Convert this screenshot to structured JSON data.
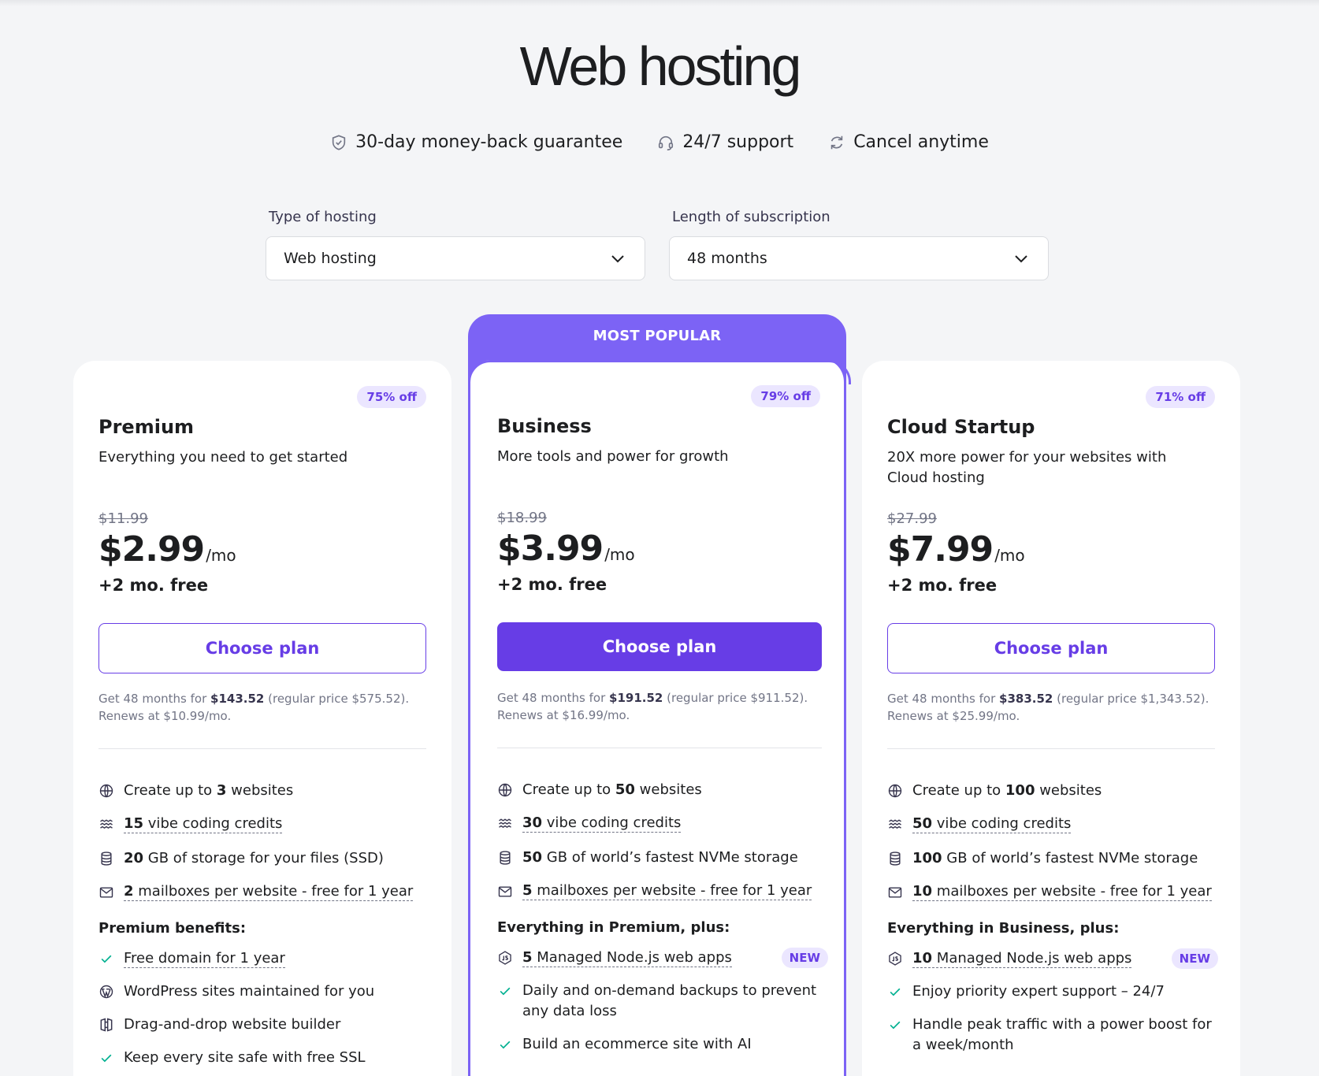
{
  "page": {
    "title": "Web hosting"
  },
  "badges": [
    {
      "icon": "shield-check-icon",
      "label": "30-day money-back guarantee"
    },
    {
      "icon": "headset-icon",
      "label": "24/7 support"
    },
    {
      "icon": "refresh-icon",
      "label": "Cancel anytime"
    }
  ],
  "filters": {
    "hosting_type": {
      "label": "Type of hosting",
      "value": "Web hosting"
    },
    "subscription": {
      "label": "Length of subscription",
      "value": "48 months"
    }
  },
  "most_popular_label": "MOST POPULAR",
  "plans": [
    {
      "discount": "75% off",
      "name": "Premium",
      "description": "Everything you need to get started",
      "old_price": "$11.99",
      "price": "$2.99",
      "per": "/mo",
      "free": "+2 mo. free",
      "cta": "Choose plan",
      "terms_pre": "Get 48 months for ",
      "terms_total": "$143.52",
      "terms_post": " (regular price $575.52). Renews at $10.99/mo.",
      "features": [
        {
          "pre": "Create up to ",
          "bold": "3",
          "post": " websites",
          "dashed": false
        },
        {
          "pre": "",
          "bold": "15",
          "post": " vibe coding credits",
          "dashed": true
        },
        {
          "pre": "",
          "bold": "20",
          "post": " GB of storage for your files (SSD)",
          "dashed": false
        },
        {
          "pre": "",
          "bold": "2",
          "post": " mailboxes per website - free for 1 year",
          "dashed": true
        }
      ],
      "benefits_title": "Premium benefits:",
      "benefits": [
        {
          "text": "Free domain for 1 year"
        },
        {
          "text": "WordPress sites maintained for you"
        },
        {
          "text": "Drag-and-drop website builder"
        },
        {
          "text": "Keep every site safe with free SSL"
        }
      ]
    },
    {
      "discount": "79% off",
      "name": "Business",
      "description": "More tools and power for growth",
      "old_price": "$18.99",
      "price": "$3.99",
      "per": "/mo",
      "free": "+2 mo. free",
      "cta": "Choose plan",
      "terms_pre": "Get 48 months for ",
      "terms_total": "$191.52",
      "terms_post": " (regular price $911.52). Renews at $16.99/mo.",
      "features": [
        {
          "pre": "Create up to ",
          "bold": "50",
          "post": " websites",
          "dashed": false
        },
        {
          "pre": "",
          "bold": "30",
          "post": " vibe coding credits",
          "dashed": true
        },
        {
          "pre": "",
          "bold": "50",
          "post": " GB of world’s fastest NVMe storage",
          "dashed": false
        },
        {
          "pre": "",
          "bold": "5",
          "post": " mailboxes per website - free for 1 year",
          "dashed": true
        }
      ],
      "benefits_title": "Everything in Premium, plus:",
      "benefits": [
        {
          "bold": "5",
          "text": " Managed Node.js web apps",
          "new": "NEW"
        },
        {
          "text": "Daily and on-demand backups to prevent any data loss"
        },
        {
          "text": "Build an ecommerce site with AI"
        }
      ]
    },
    {
      "discount": "71% off",
      "name": "Cloud Startup",
      "description": "20X more power for your websites with Cloud hosting",
      "old_price": "$27.99",
      "price": "$7.99",
      "per": "/mo",
      "free": "+2 mo. free",
      "cta": "Choose plan",
      "terms_pre": "Get 48 months for ",
      "terms_total": "$383.52",
      "terms_post": " (regular price $1,343.52). Renews at $25.99/mo.",
      "features": [
        {
          "pre": "Create up to ",
          "bold": "100",
          "post": " websites",
          "dashed": false
        },
        {
          "pre": "",
          "bold": "50",
          "post": " vibe coding credits",
          "dashed": true
        },
        {
          "pre": "",
          "bold": "100",
          "post": " GB of world’s fastest NVMe storage",
          "dashed": false
        },
        {
          "pre": "",
          "bold": "10",
          "post": " mailboxes per website - free for 1 year",
          "dashed": true
        }
      ],
      "benefits_title": "Everything in Business, plus:",
      "benefits": [
        {
          "bold": "10",
          "text": " Managed Node.js web apps",
          "new": "NEW"
        },
        {
          "text": "Enjoy priority expert support – 24/7"
        },
        {
          "text": "Handle peak traffic with a power boost for a week/month"
        }
      ]
    }
  ],
  "colors": {
    "brand": "#673de6",
    "popular": "#7c63f5",
    "background": "#f4f5f7",
    "success": "#00b090"
  }
}
